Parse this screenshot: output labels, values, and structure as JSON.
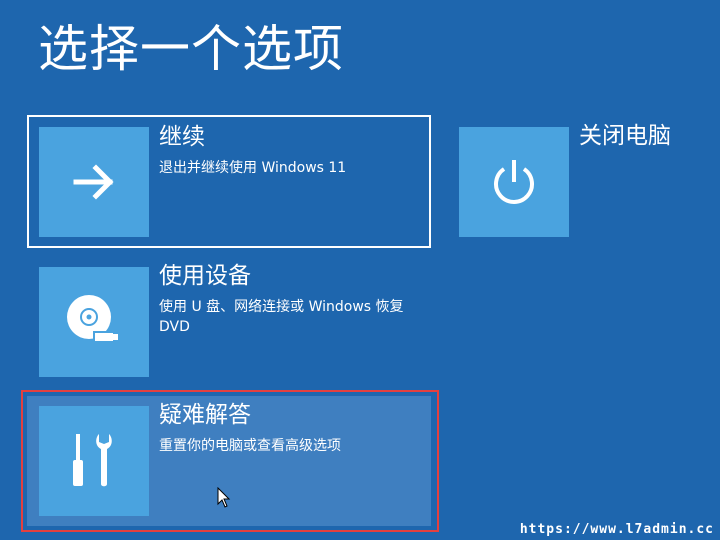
{
  "page": {
    "title": "选择一个选项"
  },
  "options": {
    "continue": {
      "title": "继续",
      "description": "退出并继续使用 Windows 11",
      "icon": "arrow-right-icon"
    },
    "use_device": {
      "title": "使用设备",
      "description": "使用 U 盘、网络连接或 Windows 恢复 DVD",
      "icon": "disc-usb-icon"
    },
    "troubleshoot": {
      "title": "疑难解答",
      "description": "重置你的电脑或查看高级选项",
      "icon": "tools-icon"
    },
    "shutdown": {
      "title": "关闭电脑",
      "icon": "power-icon"
    }
  },
  "watermark": "https://www.l7admin.cc",
  "colors": {
    "background": "#1e66ae",
    "tile": "#4aa3df",
    "hover": "#3f7fc0",
    "highlight": "#e3403f"
  }
}
